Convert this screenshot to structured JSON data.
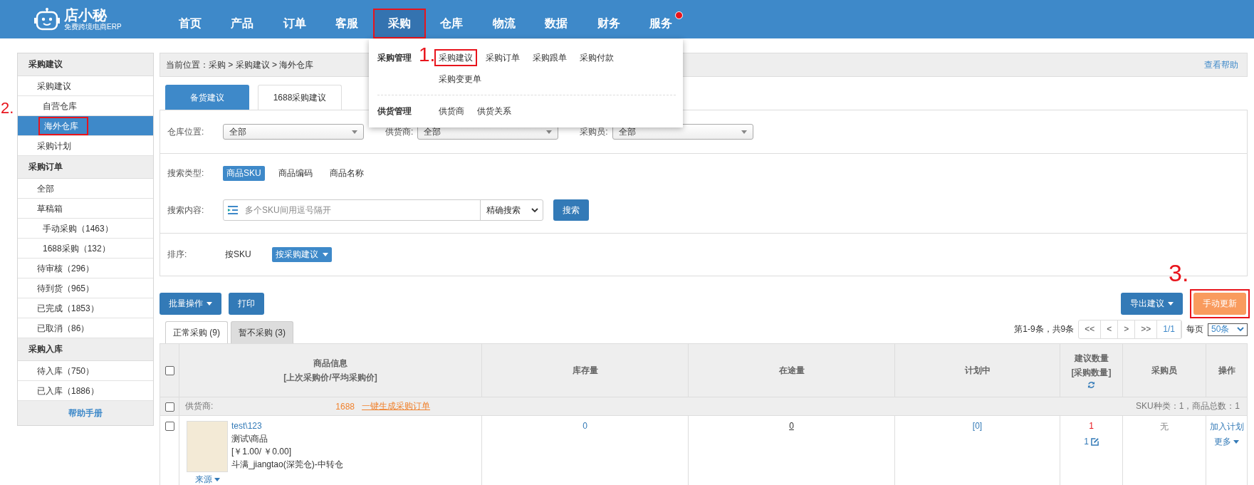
{
  "logo": {
    "name": "店小秘",
    "tagline": "免费跨境电商ERP"
  },
  "nav": [
    {
      "label": "首页",
      "selected": false,
      "outlined": false,
      "dot": false
    },
    {
      "label": "产品",
      "selected": false,
      "outlined": false,
      "dot": false
    },
    {
      "label": "订单",
      "selected": false,
      "outlined": false,
      "dot": false
    },
    {
      "label": "客服",
      "selected": false,
      "outlined": false,
      "dot": false
    },
    {
      "label": "采购",
      "selected": true,
      "outlined": true,
      "dot": false
    },
    {
      "label": "仓库",
      "selected": false,
      "outlined": false,
      "dot": false
    },
    {
      "label": "物流",
      "selected": false,
      "outlined": false,
      "dot": false
    },
    {
      "label": "数据",
      "selected": false,
      "outlined": false,
      "dot": false
    },
    {
      "label": "财务",
      "selected": false,
      "outlined": false,
      "dot": false
    },
    {
      "label": "服务",
      "selected": false,
      "outlined": false,
      "dot": true
    }
  ],
  "dropdown": {
    "groups": [
      {
        "title": "采购管理",
        "items": [
          {
            "label": "采购建议",
            "outlined": true,
            "marker": "1."
          },
          {
            "label": "采购订单",
            "outlined": false
          },
          {
            "label": "采购跟单",
            "outlined": false
          },
          {
            "label": "采购付款",
            "outlined": false
          },
          {
            "label": "采购变更单",
            "outlined": false
          }
        ]
      },
      {
        "title": "供货管理",
        "items": [
          {
            "label": "供货商",
            "outlined": false
          },
          {
            "label": "供货关系",
            "outlined": false
          }
        ]
      }
    ]
  },
  "sidebar": {
    "sections": [
      {
        "title": "采购建议",
        "items": [
          {
            "label": "采购建议",
            "selected": false,
            "outlined": false,
            "children": [
              {
                "label": "自营仓库",
                "selected": false,
                "outlined": false
              },
              {
                "label": "海外仓库",
                "selected": true,
                "outlined": true,
                "marker": "2."
              }
            ]
          },
          {
            "label": "采购计划",
            "selected": false,
            "outlined": false
          }
        ]
      },
      {
        "title": "采购订单",
        "items": [
          {
            "label": "全部",
            "selected": false,
            "outlined": false
          },
          {
            "label": "草稿箱",
            "selected": false,
            "outlined": false,
            "children": [
              {
                "label": "手动采购（1463）",
                "selected": false,
                "outlined": false
              },
              {
                "label": "1688采购（132）",
                "selected": false,
                "outlined": false
              }
            ]
          },
          {
            "label": "待审核（296）",
            "selected": false,
            "outlined": false
          },
          {
            "label": "待到货（965）",
            "selected": false,
            "outlined": false
          },
          {
            "label": "已完成（1853）",
            "selected": false,
            "outlined": false
          },
          {
            "label": "已取消（86）",
            "selected": false,
            "outlined": false
          }
        ]
      },
      {
        "title": "采购入库",
        "items": [
          {
            "label": "待入库（750）",
            "selected": false,
            "outlined": false
          },
          {
            "label": "已入库（1886）",
            "selected": false,
            "outlined": false
          }
        ]
      }
    ],
    "help": "帮助手册"
  },
  "breadcrumb": {
    "text": "当前位置：采购 > 采购建议 > 海外仓库",
    "help_link": "查看帮助"
  },
  "tabs": [
    {
      "label": "备货建议",
      "selected": true
    },
    {
      "label": "1688采购建议",
      "selected": false
    }
  ],
  "filters": [
    {
      "label": "仓库位置:",
      "value": "全部"
    },
    {
      "label": "供货商:",
      "value": "全部"
    },
    {
      "label": "采购员:",
      "value": "全部"
    }
  ],
  "search_type": {
    "label": "搜索类型:",
    "options": [
      {
        "label": "商品SKU",
        "selected": true
      },
      {
        "label": "商品编码",
        "selected": false
      },
      {
        "label": "商品名称",
        "selected": false
      }
    ]
  },
  "search": {
    "label": "搜索内容:",
    "placeholder": "多个SKU间用逗号隔开",
    "mode": "精确搜索",
    "button": "搜索"
  },
  "sort": {
    "label": "排序:",
    "options": [
      {
        "label": "按SKU",
        "selected": false
      },
      {
        "label": "按采购建议",
        "selected": true
      }
    ]
  },
  "actions_left": [
    {
      "label": "批量操作",
      "caret": true
    },
    {
      "label": "打印",
      "caret": false
    }
  ],
  "actions_right": [
    {
      "label": "导出建议",
      "kind": "primary",
      "caret": true,
      "outlined": false
    },
    {
      "label": "手动更新",
      "kind": "warning",
      "caret": false,
      "outlined": true,
      "marker": "3."
    }
  ],
  "subtabs": [
    {
      "label": "正常采购 (9)",
      "selected": true
    },
    {
      "label": "暂不采购 (3)",
      "selected": false
    }
  ],
  "pager": {
    "summary": "第1-9条，共9条",
    "buttons": [
      "<<",
      "<",
      ">",
      ">>"
    ],
    "current": "1/1",
    "per_page_label": "每页",
    "per_page": "50条"
  },
  "table": {
    "select_all": {
      "checked": false
    },
    "columns": [
      {
        "lines": [
          "商品信息",
          "[上次采购价/平均采购价]"
        ],
        "refresh": false
      },
      {
        "lines": [
          "库存量"
        ],
        "refresh": false
      },
      {
        "lines": [
          "在途量"
        ],
        "refresh": false
      },
      {
        "lines": [
          "计划中"
        ],
        "refresh": false
      },
      {
        "lines": [
          "建议数量",
          "[采购数量]"
        ],
        "refresh": true
      },
      {
        "lines": [
          "采购员"
        ],
        "refresh": false
      },
      {
        "lines": [
          "操作"
        ],
        "refresh": false
      }
    ],
    "groups": [
      {
        "checked": false,
        "supplier_label": "供货商:",
        "source": "1688",
        "action": "一键生成采购订单",
        "summary": "SKU种类：1，商品总数：1",
        "rows": [
          {
            "checked": false,
            "source_link": "来源",
            "sku": "test\\123",
            "name": "测试\\商品",
            "prices": "[￥1.00/ ￥0.00]",
            "warehouse": "斗满_jiangtao(深莞仓)-中转仓",
            "stock": "0",
            "in_transit": "0",
            "planned": "[0]",
            "suggested": "1",
            "purchase_qty": "1",
            "buyer": "无",
            "actions": [
              "加入计划",
              "更多"
            ]
          }
        ]
      }
    ]
  }
}
